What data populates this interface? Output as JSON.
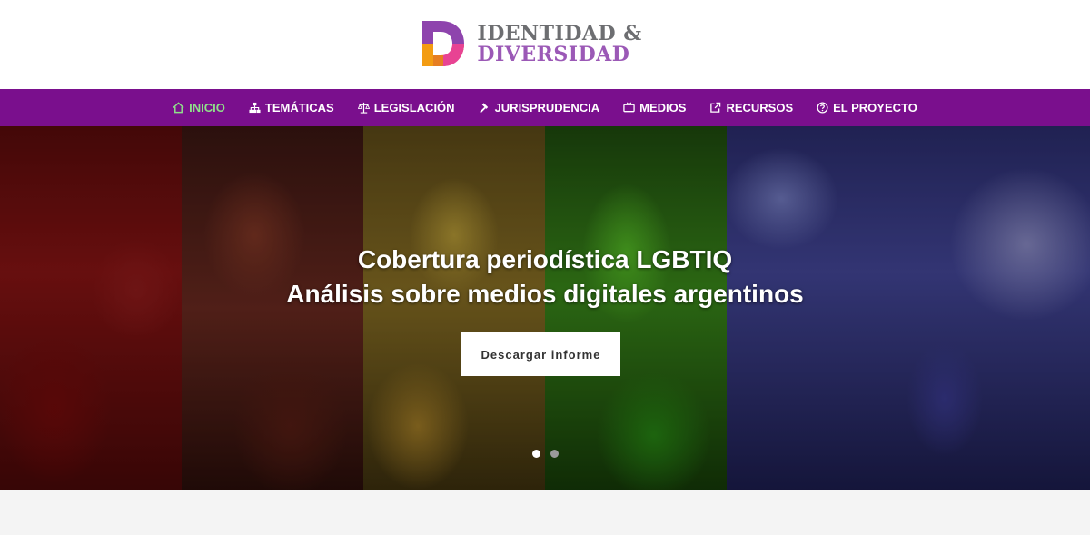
{
  "header": {
    "logo_line1": "IDENTIDAD &",
    "logo_line2": "DIVERSIDAD"
  },
  "nav": {
    "items": [
      {
        "label": "INICIO",
        "icon": "home-icon",
        "active": true
      },
      {
        "label": "TEMÁTICAS",
        "icon": "sitemap-icon",
        "active": false
      },
      {
        "label": "LEGISLACIÓN",
        "icon": "balance-scale-icon",
        "active": false
      },
      {
        "label": "JURISPRUDENCIA",
        "icon": "gavel-icon",
        "active": false
      },
      {
        "label": "MEDIOS",
        "icon": "tv-icon",
        "active": false
      },
      {
        "label": "RECURSOS",
        "icon": "external-link-icon",
        "active": false
      },
      {
        "label": "EL PROYECTO",
        "icon": "question-circle-icon",
        "active": false
      }
    ]
  },
  "hero": {
    "title_line1": "Cobertura periodística LGBTIQ",
    "title_line2": "Análisis sobre medios digitales argentinos",
    "cta_label": "Descargar informe",
    "slide_count": 2,
    "active_slide": 1
  },
  "colors": {
    "nav_bg": "#7a0f8d",
    "nav_active": "#8fe08a",
    "logo_gray": "#6d6e71",
    "logo_purple": "#9b59b6"
  }
}
